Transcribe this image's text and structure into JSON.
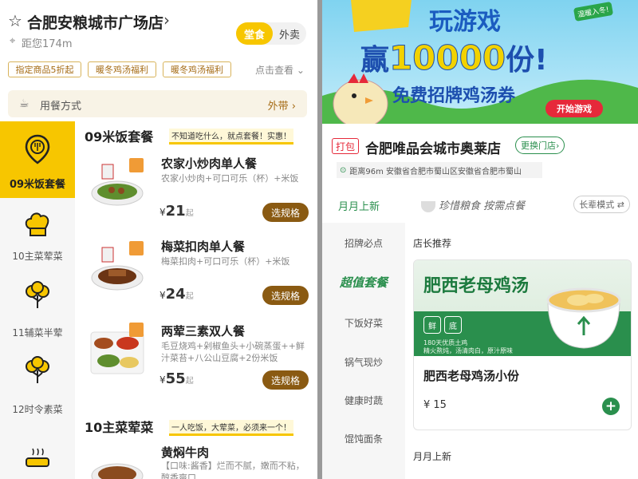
{
  "left": {
    "store_name": "合肥安粮城市广场店",
    "distance": "距您174m",
    "mode_tabs": [
      "堂食",
      "外卖"
    ],
    "promos": [
      "指定商品5折起",
      "暖冬鸡汤福利",
      "暖冬鸡汤福利"
    ],
    "promo_more": "点击查看",
    "dining": {
      "label": "用餐方式",
      "value": "外带"
    },
    "categories": [
      "09米饭套餐",
      "10主菜荤菜",
      "11辅菜半荤",
      "12时令素菜"
    ],
    "sections": [
      {
        "title": "09米饭套餐",
        "tip": "不知道吃什么，就点套餐！实惠！"
      },
      {
        "title": "10主菜荤菜",
        "tip": "一人吃饭，大荤菜，必须来一个！"
      }
    ],
    "dishes": [
      {
        "name": "农家小炒肉单人餐",
        "desc": "农家小炒肉+可口可乐（杯）+米饭",
        "currency": "¥",
        "price": "21",
        "suffix": "起",
        "button": "选规格"
      },
      {
        "name": "梅菜扣肉单人餐",
        "desc": "梅菜扣肉+可口可乐（杯）+米饭",
        "currency": "¥",
        "price": "24",
        "suffix": "起",
        "button": "选规格"
      },
      {
        "name": "两荤三素双人餐",
        "desc": "毛豆烧鸡+剁椒鱼头+小碗蒸蛋++鲜汁菜苔+八公山豆腐+2份米饭",
        "currency": "¥",
        "price": "55",
        "suffix": "起",
        "button": "选规格"
      },
      {
        "name": "黄焖牛肉",
        "desc": "【口味:酱香】烂而不腻，嫩而不粘，醇香爽口"
      }
    ]
  },
  "right": {
    "banner": {
      "title": "玩游戏",
      "line2_a": "赢",
      "line2_num": "10000",
      "line2_b": "份!",
      "line3": "免费招牌鸡汤券",
      "button": "开始游戏",
      "tag": "温暖入冬!"
    },
    "pack_label": "打包",
    "store_name": "合肥唯品会城市奥莱店",
    "switch_label": "更换门店",
    "address": "距离96m  安徽省合肥市蜀山区安徽省合肥市蜀山",
    "tab_new": "月月上新",
    "slogan": "珍惜粮食 按需点餐",
    "mode_label": "长辈模式",
    "categories": [
      "招牌必点",
      "超值套餐",
      "下饭好菜",
      "锅气现炒",
      "健康时蔬",
      "馄饨面条"
    ],
    "recommend_title": "店长推荐",
    "card": {
      "banner_title": "肥西老母鸡汤",
      "badges": [
        "鲜",
        "底"
      ],
      "fine1": "180天优质土鸡",
      "fine2": "精火熬炖，汤清肉白，原汁原味",
      "name": "肥西老母鸡汤小份",
      "price": "¥ 15"
    },
    "bottom_section": "月月上新"
  }
}
